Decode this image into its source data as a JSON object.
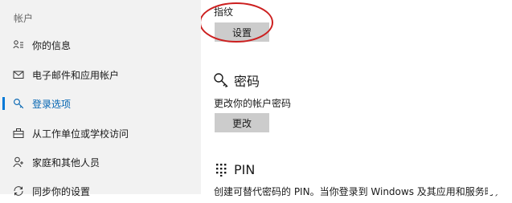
{
  "sidebar": {
    "section_title": "帐户",
    "items": [
      {
        "label": "你的信息",
        "icon": "person-card-icon"
      },
      {
        "label": "电子邮件和应用帐户",
        "icon": "envelope-icon"
      },
      {
        "label": "登录选项",
        "icon": "key-icon",
        "active": true
      },
      {
        "label": "从工作单位或学校访问",
        "icon": "briefcase-icon"
      },
      {
        "label": "家庭和其他人员",
        "icon": "person-icon"
      },
      {
        "label": "同步你的设置",
        "icon": "sync-icon"
      }
    ]
  },
  "fingerprint": {
    "label": "指纹",
    "button_label": "设置"
  },
  "password": {
    "title": "密码",
    "icon": "key-icon",
    "description": "更改你的帐户密码",
    "button_label": "更改"
  },
  "pin": {
    "title": "PIN",
    "icon": "keypad-icon",
    "description": "创建可替代密码的 PIN。当你登录到 Windows 及其应用和服务时，"
  },
  "colors": {
    "accent": "#0078d7",
    "annotation": "#cc1f1f",
    "button": "#cccccc",
    "sidebar_bg": "#f2f2f2"
  }
}
